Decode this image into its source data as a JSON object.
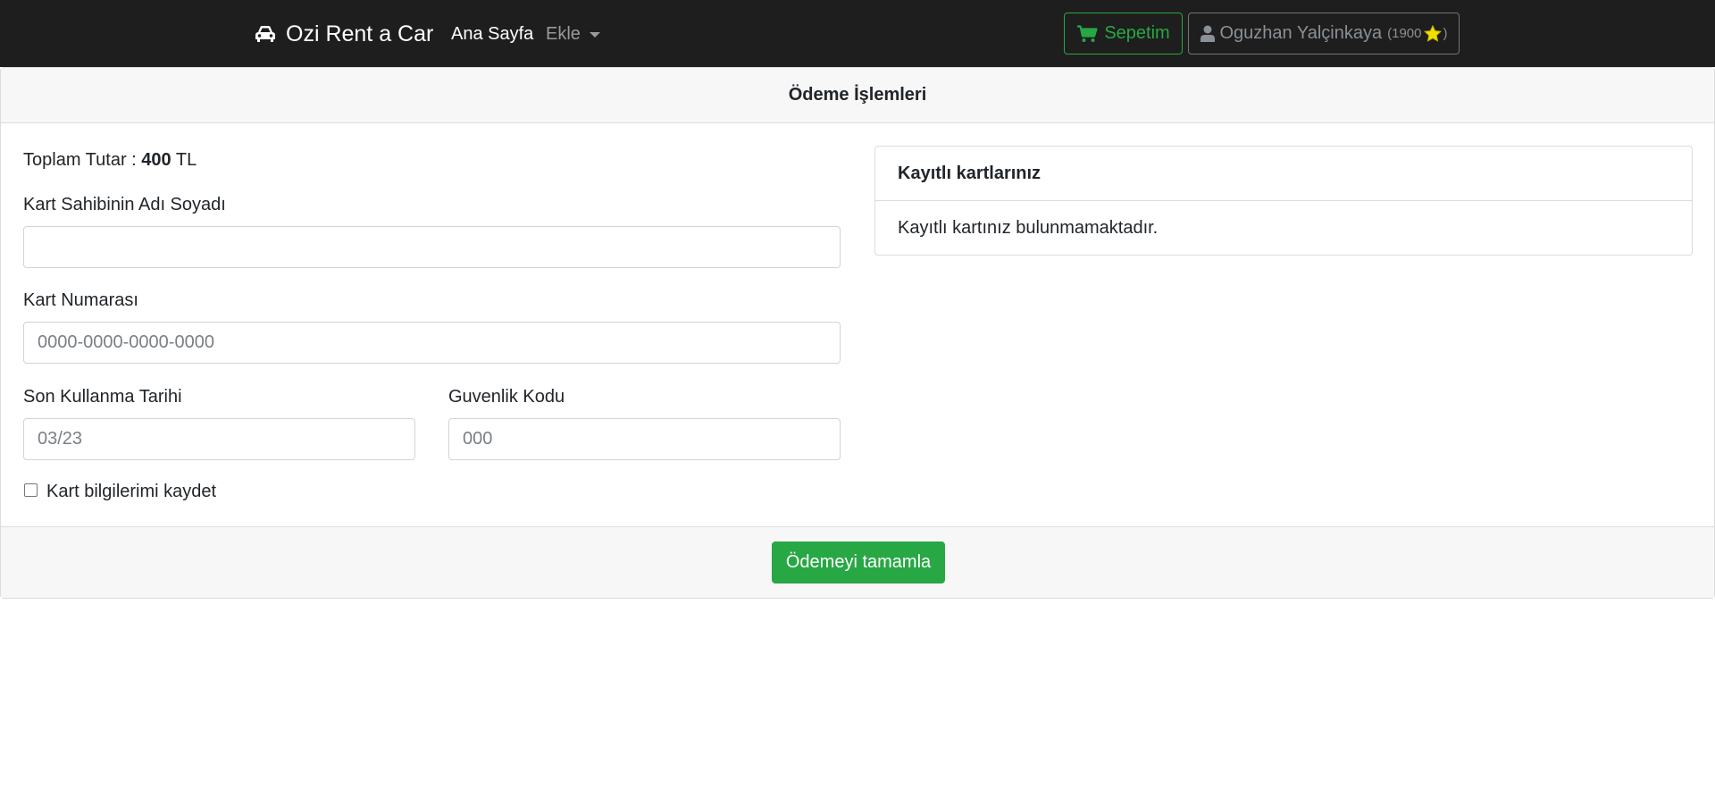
{
  "navbar": {
    "brand": "Ozi Rent a Car",
    "brand_icon": "car-icon",
    "home": "Ana Sayfa",
    "add": "Ekle",
    "cart": "Sepetim",
    "cart_icon": "shopping-cart-icon",
    "user_name": "Oguzhan Yalçinkaya",
    "user_icon": "user-icon",
    "points_open": "(1900",
    "points_icon": "star-icon",
    "points_close": ")"
  },
  "colors": {
    "navbar_bg": "#1e1e1e",
    "success": "#28a745",
    "secondary": "#6c757d",
    "star": "#f0e000"
  },
  "payment": {
    "header": "Ödeme İşlemleri",
    "total_label": "Toplam Tutar :",
    "total_value": "400",
    "total_currency": "TL",
    "name_label": "Kart Sahibinin Adı Soyadı",
    "name_value": "",
    "number_label": "Kart Numarası",
    "number_placeholder": "0000-0000-0000-0000",
    "expiry_label": "Son Kullanma Tarihi",
    "expiry_placeholder": "03/23",
    "cvv_label": "Guvenlik Kodu",
    "cvv_placeholder": "000",
    "save_label": "Kart bilgilerimi kaydet",
    "save_checked": false,
    "submit": "Ödemeyi tamamla"
  },
  "saved_cards": {
    "title": "Kayıtlı kartlarınız",
    "empty_text": "Kayıtlı kartınız bulunmamaktadır."
  }
}
